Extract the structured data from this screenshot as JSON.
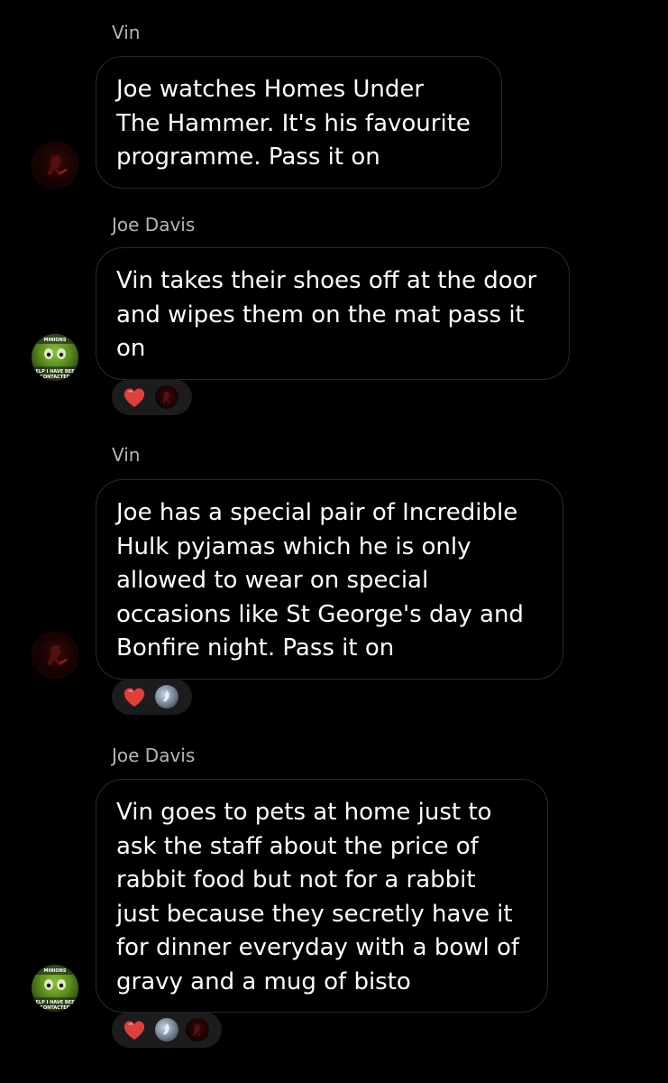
{
  "messages": [
    {
      "sender": "Vin",
      "text": "Joe watches Homes Under\nThe Hammer. It's his favourite\nprogramme. Pass it on",
      "avatar_icon": "vin-avatar",
      "reactions": []
    },
    {
      "sender": "Joe Davis",
      "text": "Vin takes their shoes off at the door\nand wipes them on the mat pass it\non",
      "avatar_icon": "joe-davis-avatar",
      "avatar_caption": "HELP I HAVE BEEN CONTACTED",
      "reactions": [
        "heart-emoji",
        "vin-avatar"
      ]
    },
    {
      "sender": "Vin",
      "text": "Joe has a special pair of Incredible\nHulk pyjamas which he is only\nallowed to wear on special\noccasions like St George's day and\nBonfire night. Pass it on",
      "avatar_icon": "vin-avatar",
      "reactions": [
        "heart-emoji",
        "grey-avatar"
      ]
    },
    {
      "sender": "Joe Davis",
      "text": "Vin goes to pets at home just to\nask the staff about the price of\nrabbit food but not for a rabbit\njust because they secretly have it\nfor dinner everyday with a bowl of\ngravy and a mug of bisto",
      "avatar_icon": "joe-davis-avatar",
      "avatar_caption": "HELP I HAVE BEEN CONTACTED",
      "reactions": [
        "heart-emoji",
        "grey-avatar",
        "vin-avatar"
      ]
    }
  ],
  "colors": {
    "background": "#000000",
    "bubble_border": "#2a2a2a",
    "sender_text": "#b5b5b5",
    "reaction_pill": "#1c1c1e",
    "heart": "#e0403c"
  }
}
